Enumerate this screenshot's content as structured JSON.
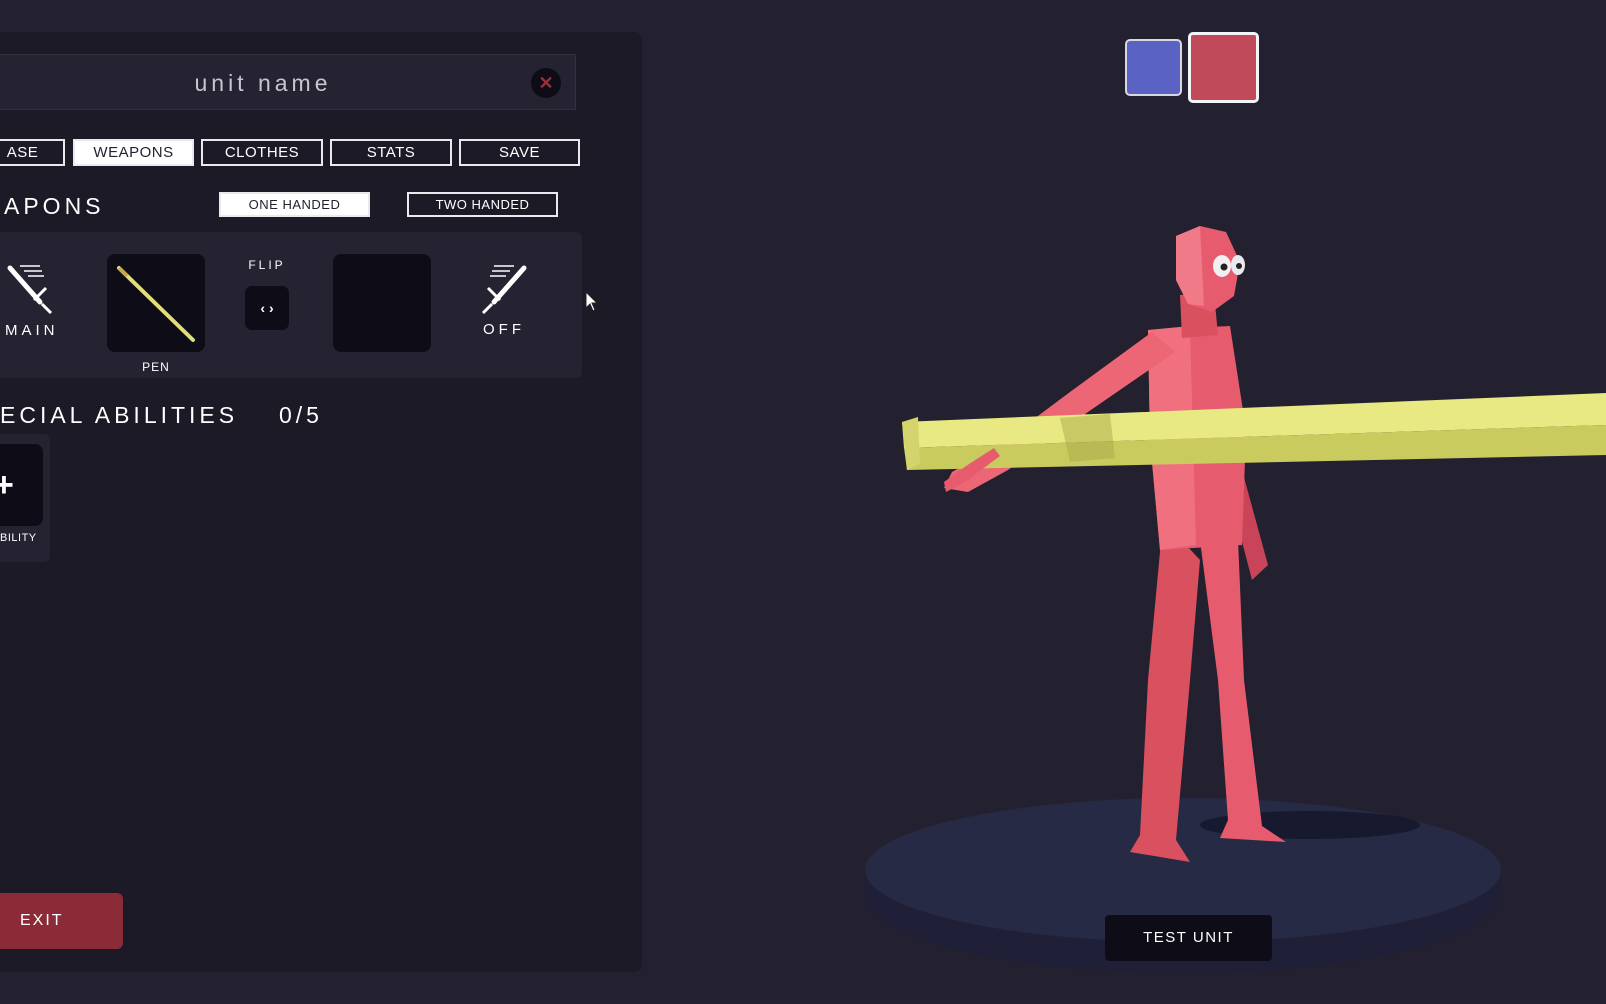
{
  "header": {
    "unit_name": "unit name",
    "close_symbol": "✕"
  },
  "tabs": [
    {
      "label": "ASE",
      "active": false
    },
    {
      "label": "WEAPONS",
      "active": true
    },
    {
      "label": "CLOTHES",
      "active": false
    },
    {
      "label": "STATS",
      "active": false
    },
    {
      "label": "SAVE",
      "active": false
    }
  ],
  "weapons": {
    "title": "APONS",
    "one_handed_label": "ONE HANDED",
    "two_handed_label": "TWO HANDED",
    "selected_mode": "ONE HANDED",
    "main_label": "MAIN",
    "main_weapon_name": "PEN",
    "flip_label": "FLIP",
    "flip_symbol": "‹ ›",
    "off_label": "OFF",
    "main_icon": "sword-icon",
    "off_icon": "sword-icon"
  },
  "abilities": {
    "title": "ECIAL ABILITIES",
    "count": "0/5",
    "add_symbol": "+",
    "add_label": "BILITY"
  },
  "exit_label": "EXIT",
  "team_colors": {
    "blue": "#5a63c4",
    "red": "#c04a5a",
    "selected": "red"
  },
  "unit_color": "#e65c6e",
  "weapon_color": "#dfe07a",
  "test_unit_label": "TEST UNIT"
}
